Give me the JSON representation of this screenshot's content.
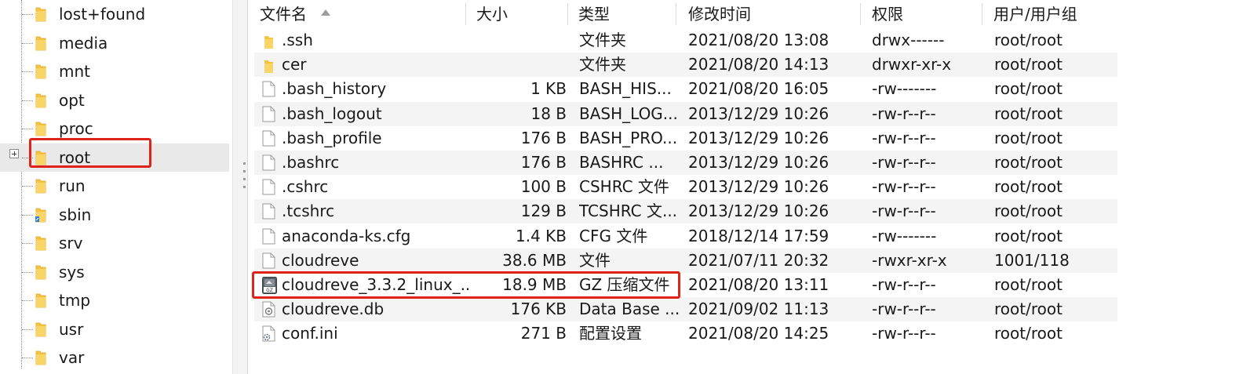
{
  "tree": {
    "items": [
      {
        "label": "lost+found"
      },
      {
        "label": "media"
      },
      {
        "label": "mnt"
      },
      {
        "label": "opt"
      },
      {
        "label": "proc"
      },
      {
        "label": "root"
      },
      {
        "label": "run"
      },
      {
        "label": "sbin"
      },
      {
        "label": "srv"
      },
      {
        "label": "sys"
      },
      {
        "label": "tmp"
      },
      {
        "label": "usr"
      },
      {
        "label": "var"
      }
    ],
    "selected": "root"
  },
  "columns": {
    "name": "文件名",
    "size": "大小",
    "type": "类型",
    "modified": "修改时间",
    "permissions": "权限",
    "owner": "用户/用户组"
  },
  "files": [
    {
      "name": ".ssh",
      "size": "",
      "type": "文件夹",
      "modified": "2021/08/20 13:08",
      "permissions": "drwx------",
      "owner": "root/root",
      "icon": "folder-icon"
    },
    {
      "name": "cer",
      "size": "",
      "type": "文件夹",
      "modified": "2021/08/20 14:13",
      "permissions": "drwxr-xr-x",
      "owner": "root/root",
      "icon": "folder-icon"
    },
    {
      "name": ".bash_history",
      "size": "1 KB",
      "type": "BASH_HIS...",
      "modified": "2021/08/20 16:05",
      "permissions": "-rw-------",
      "owner": "root/root",
      "icon": "file-icon"
    },
    {
      "name": ".bash_logout",
      "size": "18 B",
      "type": "BASH_LOG...",
      "modified": "2013/12/29 10:26",
      "permissions": "-rw-r--r--",
      "owner": "root/root",
      "icon": "file-icon"
    },
    {
      "name": ".bash_profile",
      "size": "176 B",
      "type": "BASH_PRO...",
      "modified": "2013/12/29 10:26",
      "permissions": "-rw-r--r--",
      "owner": "root/root",
      "icon": "file-icon"
    },
    {
      "name": ".bashrc",
      "size": "176 B",
      "type": "BASHRC ...",
      "modified": "2013/12/29 10:26",
      "permissions": "-rw-r--r--",
      "owner": "root/root",
      "icon": "file-icon"
    },
    {
      "name": ".cshrc",
      "size": "100 B",
      "type": "CSHRC 文件",
      "modified": "2013/12/29 10:26",
      "permissions": "-rw-r--r--",
      "owner": "root/root",
      "icon": "file-icon"
    },
    {
      "name": ".tcshrc",
      "size": "129 B",
      "type": "TCSHRC 文...",
      "modified": "2013/12/29 10:26",
      "permissions": "-rw-r--r--",
      "owner": "root/root",
      "icon": "file-icon"
    },
    {
      "name": "anaconda-ks.cfg",
      "size": "1.4 KB",
      "type": "CFG 文件",
      "modified": "2018/12/14 17:59",
      "permissions": "-rw-------",
      "owner": "root/root",
      "icon": "file-icon"
    },
    {
      "name": "cloudreve",
      "size": "38.6 MB",
      "type": "文件",
      "modified": "2021/07/11 20:32",
      "permissions": "-rwxr-xr-x",
      "owner": "1001/118",
      "icon": "file-icon"
    },
    {
      "name": "cloudreve_3.3.2_linux_...",
      "size": "18.9 MB",
      "type": "GZ 压缩文件",
      "modified": "2021/08/20 13:11",
      "permissions": "-rw-r--r--",
      "owner": "root/root",
      "icon": "gz-archive-icon"
    },
    {
      "name": "cloudreve.db",
      "size": "176 KB",
      "type": "Data Base ...",
      "modified": "2021/09/02 11:13",
      "permissions": "-rw-r--r--",
      "owner": "root/root",
      "icon": "database-file-icon"
    },
    {
      "name": "conf.ini",
      "size": "271 B",
      "type": "配置设置",
      "modified": "2021/08/20 14:25",
      "permissions": "-rw-r--r--",
      "owner": "root/root",
      "icon": "settings-file-icon"
    }
  ],
  "colors": {
    "highlight": "#e0231a",
    "folder": "#f6c343",
    "selected_row": "#e9e9e9",
    "alt_row": "#f4f4f4"
  }
}
